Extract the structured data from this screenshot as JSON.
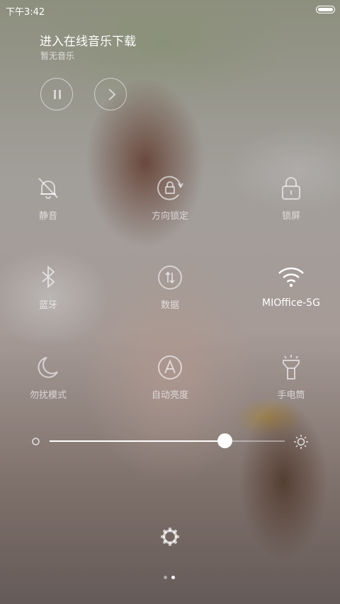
{
  "status_bar": {
    "time": "下午3:42"
  },
  "music": {
    "title": "进入在线音乐下载",
    "subtitle": "暂无音乐",
    "controls": [
      "pause-icon",
      "next-icon"
    ]
  },
  "toggles": [
    {
      "label": "静音",
      "icon": "mute-bell-icon",
      "active": false
    },
    {
      "label": "方向锁定",
      "icon": "rotation-lock-icon",
      "active": false
    },
    {
      "label": "锁屏",
      "icon": "lock-icon",
      "active": false
    },
    {
      "label": "蓝牙",
      "icon": "bluetooth-icon",
      "active": false
    },
    {
      "label": "数据",
      "icon": "mobile-data-icon",
      "active": false
    },
    {
      "label": "MIOffice-5G",
      "icon": "wifi-icon",
      "active": true
    },
    {
      "label": "勿扰模式",
      "icon": "moon-icon",
      "active": false
    },
    {
      "label": "自动亮度",
      "icon": "auto-brightness-icon",
      "active": false
    },
    {
      "label": "手电筒",
      "icon": "flashlight-icon",
      "active": false
    }
  ],
  "brightness": {
    "level": 0.745,
    "min_icon": "brightness-low-icon",
    "max_icon": "brightness-high-icon"
  },
  "settings": {
    "icon": "gear-icon"
  },
  "pager": {
    "pages": 2,
    "current": 2
  }
}
